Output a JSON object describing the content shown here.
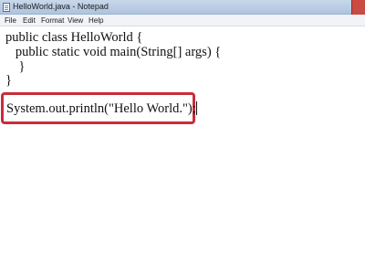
{
  "window": {
    "title": "HelloWorld.java - Notepad",
    "app_icon": "notepad-icon"
  },
  "menu": {
    "file": "File",
    "edit": "Edit",
    "format": "Format",
    "view": "View",
    "help": "Help"
  },
  "editor": {
    "lines": [
      "public class HelloWorld {",
      "   public static void main(String[] args) {",
      "    }",
      "}"
    ],
    "highlighted_line": "System.out.println(\"Hello World.\");"
  },
  "colors": {
    "highlight_border": "#c92d3b"
  }
}
